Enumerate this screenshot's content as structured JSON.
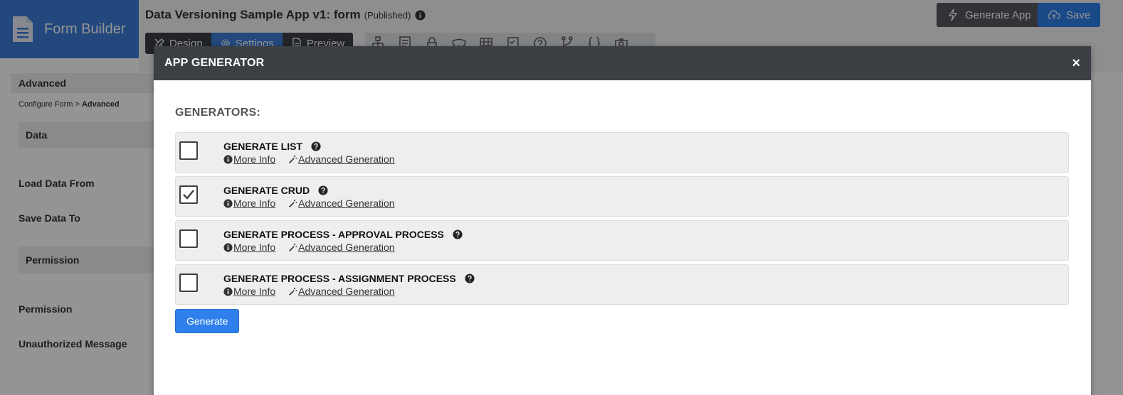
{
  "brand": {
    "name": "Form Builder"
  },
  "header": {
    "app_title": "Data Versioning Sample App v1: form",
    "status": "(Published)"
  },
  "tabs": [
    {
      "label": "Design",
      "active": false
    },
    {
      "label": "Settings",
      "active": true
    },
    {
      "label": "Preview",
      "active": false
    }
  ],
  "toolbar_icons": [
    "sitemap-icon",
    "form-icon",
    "lock-icon",
    "mask-icon",
    "table-icon",
    "checklist-icon",
    "question-icon",
    "branch-icon",
    "braces-icon",
    "camera-icon"
  ],
  "actions": {
    "generate_app": "Generate App",
    "save": "Save"
  },
  "sidebar": {
    "header": "Advanced",
    "breadcrumb_parent": "Configure Form",
    "breadcrumb_sep": ">",
    "breadcrumb_current": "Advanced",
    "section_data": "Data",
    "load_data_from": "Load Data From",
    "save_data_to": "Save Data To",
    "section_permission": "Permission",
    "permission": "Permission",
    "unauthorized_message": "Unauthorized Message"
  },
  "modal": {
    "title": "APP GENERATOR",
    "close": "×",
    "heading": "GENERATORS:",
    "more_info": "More Info",
    "advanced_generation": "Advanced Generation",
    "generate_button": "Generate",
    "generators": [
      {
        "name": "GENERATE LIST",
        "checked": false
      },
      {
        "name": "GENERATE CRUD",
        "checked": true
      },
      {
        "name": "GENERATE PROCESS - APPROVAL PROCESS",
        "checked": false
      },
      {
        "name": "GENERATE PROCESS - ASSIGNMENT PROCESS",
        "checked": false
      }
    ]
  },
  "colors": {
    "brand_blue": "#3b7dd8",
    "primary_button": "#2f80ed",
    "modal_header": "#3c3f44"
  }
}
